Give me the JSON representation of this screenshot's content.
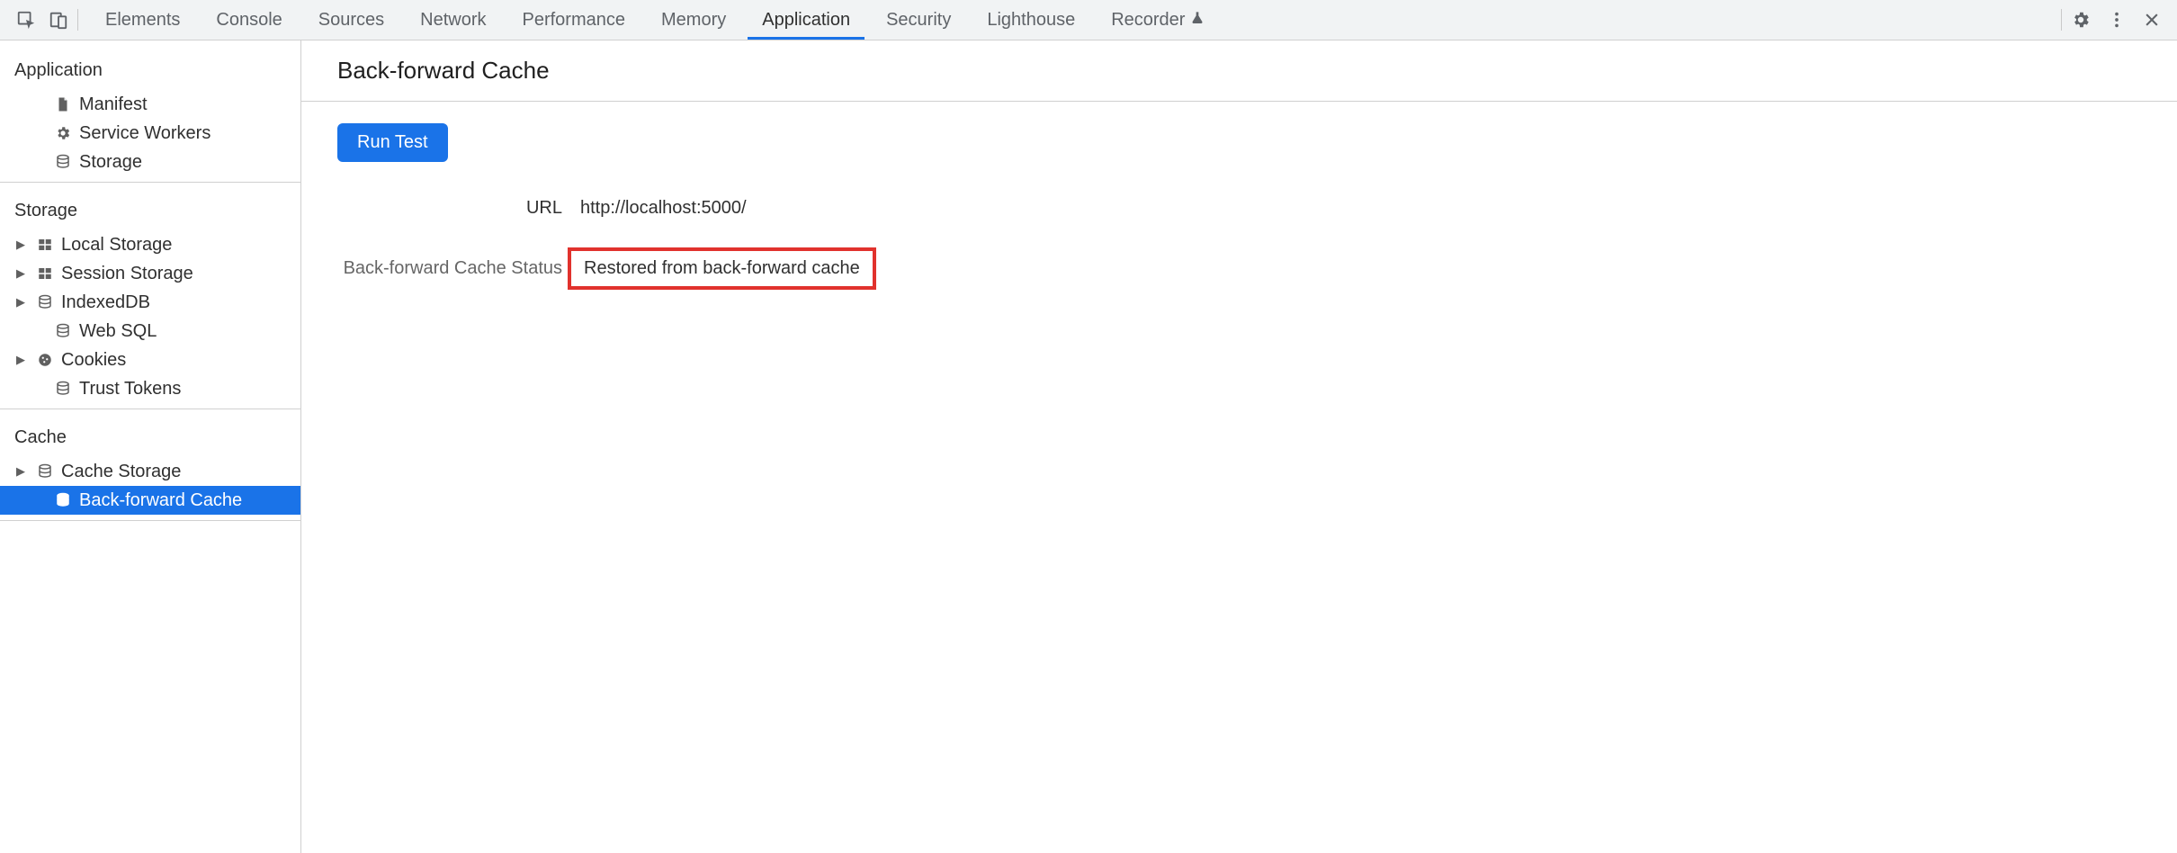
{
  "tabs": [
    {
      "label": "Elements"
    },
    {
      "label": "Console"
    },
    {
      "label": "Sources"
    },
    {
      "label": "Network"
    },
    {
      "label": "Performance"
    },
    {
      "label": "Memory"
    },
    {
      "label": "Application",
      "active": true
    },
    {
      "label": "Security"
    },
    {
      "label": "Lighthouse"
    },
    {
      "label": "Recorder",
      "experimental": true
    }
  ],
  "sidebar": {
    "sections": [
      {
        "title": "Application",
        "items": [
          {
            "label": "Manifest",
            "icon": "file"
          },
          {
            "label": "Service Workers",
            "icon": "gear"
          },
          {
            "label": "Storage",
            "icon": "db"
          }
        ]
      },
      {
        "title": "Storage",
        "items": [
          {
            "label": "Local Storage",
            "icon": "table",
            "expandable": true
          },
          {
            "label": "Session Storage",
            "icon": "table",
            "expandable": true
          },
          {
            "label": "IndexedDB",
            "icon": "db",
            "expandable": true
          },
          {
            "label": "Web SQL",
            "icon": "db"
          },
          {
            "label": "Cookies",
            "icon": "cookie",
            "expandable": true
          },
          {
            "label": "Trust Tokens",
            "icon": "db"
          }
        ]
      },
      {
        "title": "Cache",
        "items": [
          {
            "label": "Cache Storage",
            "icon": "db",
            "expandable": true
          },
          {
            "label": "Back-forward Cache",
            "icon": "db",
            "selected": true
          }
        ]
      }
    ]
  },
  "page": {
    "title": "Back-forward Cache",
    "run_button": "Run Test",
    "url_label": "URL",
    "url_value": "http://localhost:5000/",
    "status_label": "Back-forward Cache Status",
    "status_value": "Restored from back-forward cache"
  }
}
